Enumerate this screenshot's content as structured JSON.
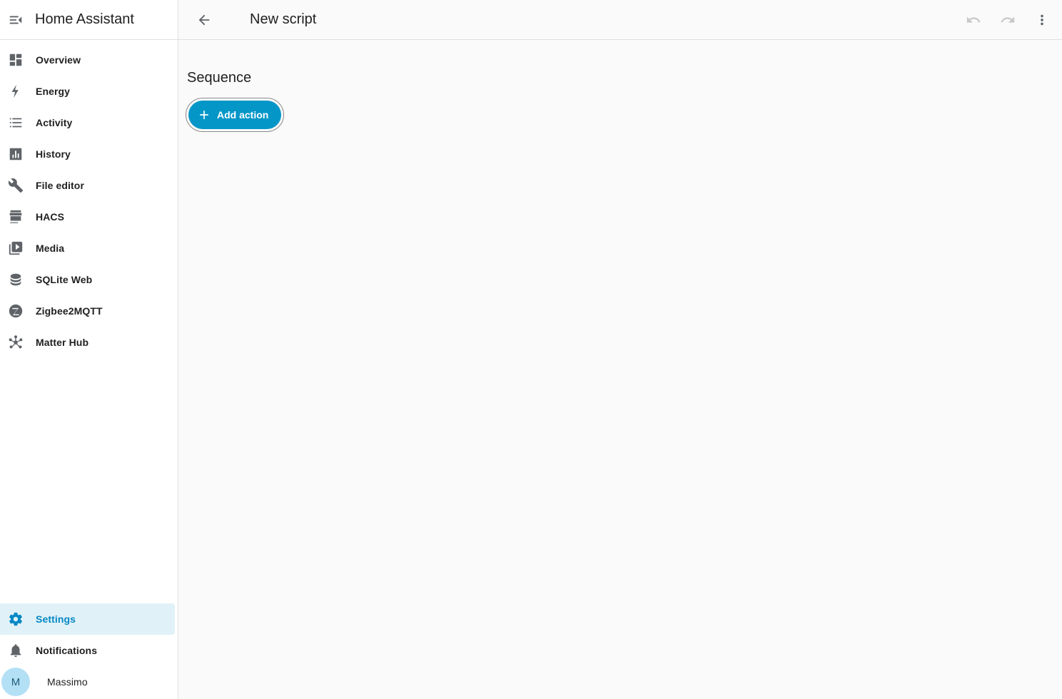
{
  "sidebar": {
    "title": "Home Assistant",
    "items": [
      {
        "label": "Overview",
        "icon": "dashboard-icon"
      },
      {
        "label": "Energy",
        "icon": "lightning-icon"
      },
      {
        "label": "Activity",
        "icon": "list-icon"
      },
      {
        "label": "History",
        "icon": "bar-chart-icon"
      },
      {
        "label": "File editor",
        "icon": "wrench-icon"
      },
      {
        "label": "HACS",
        "icon": "hacs-store-icon"
      },
      {
        "label": "Media",
        "icon": "play-box-icon"
      },
      {
        "label": "SQLite Web",
        "icon": "database-icon"
      },
      {
        "label": "Zigbee2MQTT",
        "icon": "zigbee-icon"
      },
      {
        "label": "Matter Hub",
        "icon": "hub-icon"
      }
    ],
    "bottom": {
      "settings": "Settings",
      "notifications": "Notifications",
      "user_initial": "M",
      "user_name": "Massimo"
    },
    "accent_color": "#0388c4"
  },
  "topbar": {
    "title": "New script"
  },
  "editor": {
    "section_title": "Sequence",
    "add_action_label": "Add action",
    "button_color": "#0596c8"
  }
}
